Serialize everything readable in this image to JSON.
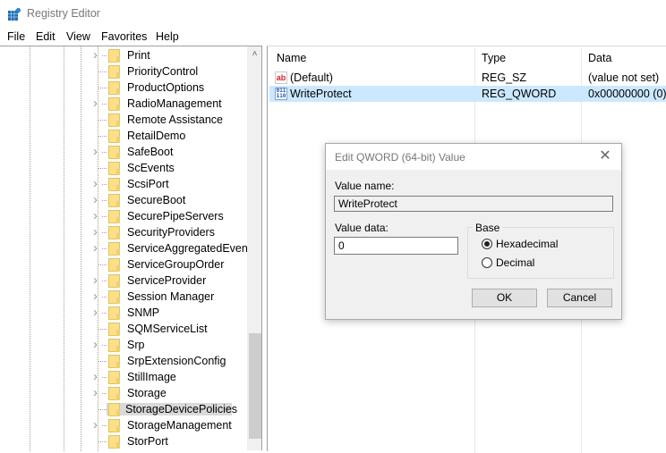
{
  "window": {
    "title": "Registry Editor",
    "app_icon": "registry-editor-icon"
  },
  "menu": [
    "File",
    "Edit",
    "View",
    "Favorites",
    "Help"
  ],
  "tree": {
    "items": [
      {
        "label": "Print",
        "expandable": true
      },
      {
        "label": "PriorityControl",
        "expandable": false
      },
      {
        "label": "ProductOptions",
        "expandable": false
      },
      {
        "label": "RadioManagement",
        "expandable": true
      },
      {
        "label": "Remote Assistance",
        "expandable": false
      },
      {
        "label": "RetailDemo",
        "expandable": false
      },
      {
        "label": "SafeBoot",
        "expandable": true
      },
      {
        "label": "ScEvents",
        "expandable": false
      },
      {
        "label": "ScsiPort",
        "expandable": true
      },
      {
        "label": "SecureBoot",
        "expandable": true
      },
      {
        "label": "SecurePipeServers",
        "expandable": true
      },
      {
        "label": "SecurityProviders",
        "expandable": true
      },
      {
        "label": "ServiceAggregatedEvents",
        "expandable": true
      },
      {
        "label": "ServiceGroupOrder",
        "expandable": false
      },
      {
        "label": "ServiceProvider",
        "expandable": true
      },
      {
        "label": "Session Manager",
        "expandable": true
      },
      {
        "label": "SNMP",
        "expandable": true
      },
      {
        "label": "SQMServiceList",
        "expandable": false
      },
      {
        "label": "Srp",
        "expandable": true
      },
      {
        "label": "SrpExtensionConfig",
        "expandable": false
      },
      {
        "label": "StillImage",
        "expandable": true
      },
      {
        "label": "Storage",
        "expandable": true
      },
      {
        "label": "StorageDevicePolicies",
        "expandable": false,
        "selected": true
      },
      {
        "label": "StorageManagement",
        "expandable": true
      },
      {
        "label": "StorPort",
        "expandable": false
      }
    ]
  },
  "list": {
    "columns": [
      "Name",
      "Type",
      "Data"
    ],
    "rows": [
      {
        "icon": "string-value-icon",
        "name": "(Default)",
        "type": "REG_SZ",
        "data": "(value not set)",
        "selected": false
      },
      {
        "icon": "binary-value-icon",
        "name": "WriteProtect",
        "type": "REG_QWORD",
        "data": "0x00000000 (0)",
        "selected": true
      }
    ]
  },
  "dialog": {
    "title": "Edit QWORD (64-bit) Value",
    "value_name_label": "Value name:",
    "value_name": "WriteProtect",
    "value_data_label": "Value data:",
    "value_data": "0",
    "base_label": "Base",
    "base_options": [
      {
        "label": "Hexadecimal",
        "checked": true
      },
      {
        "label": "Decimal",
        "checked": false
      }
    ],
    "ok_label": "OK",
    "cancel_label": "Cancel"
  },
  "colors": {
    "selection_list": "#cce8ff",
    "selection_tree": "#d9d9d9",
    "folder": "#fbe08a"
  }
}
